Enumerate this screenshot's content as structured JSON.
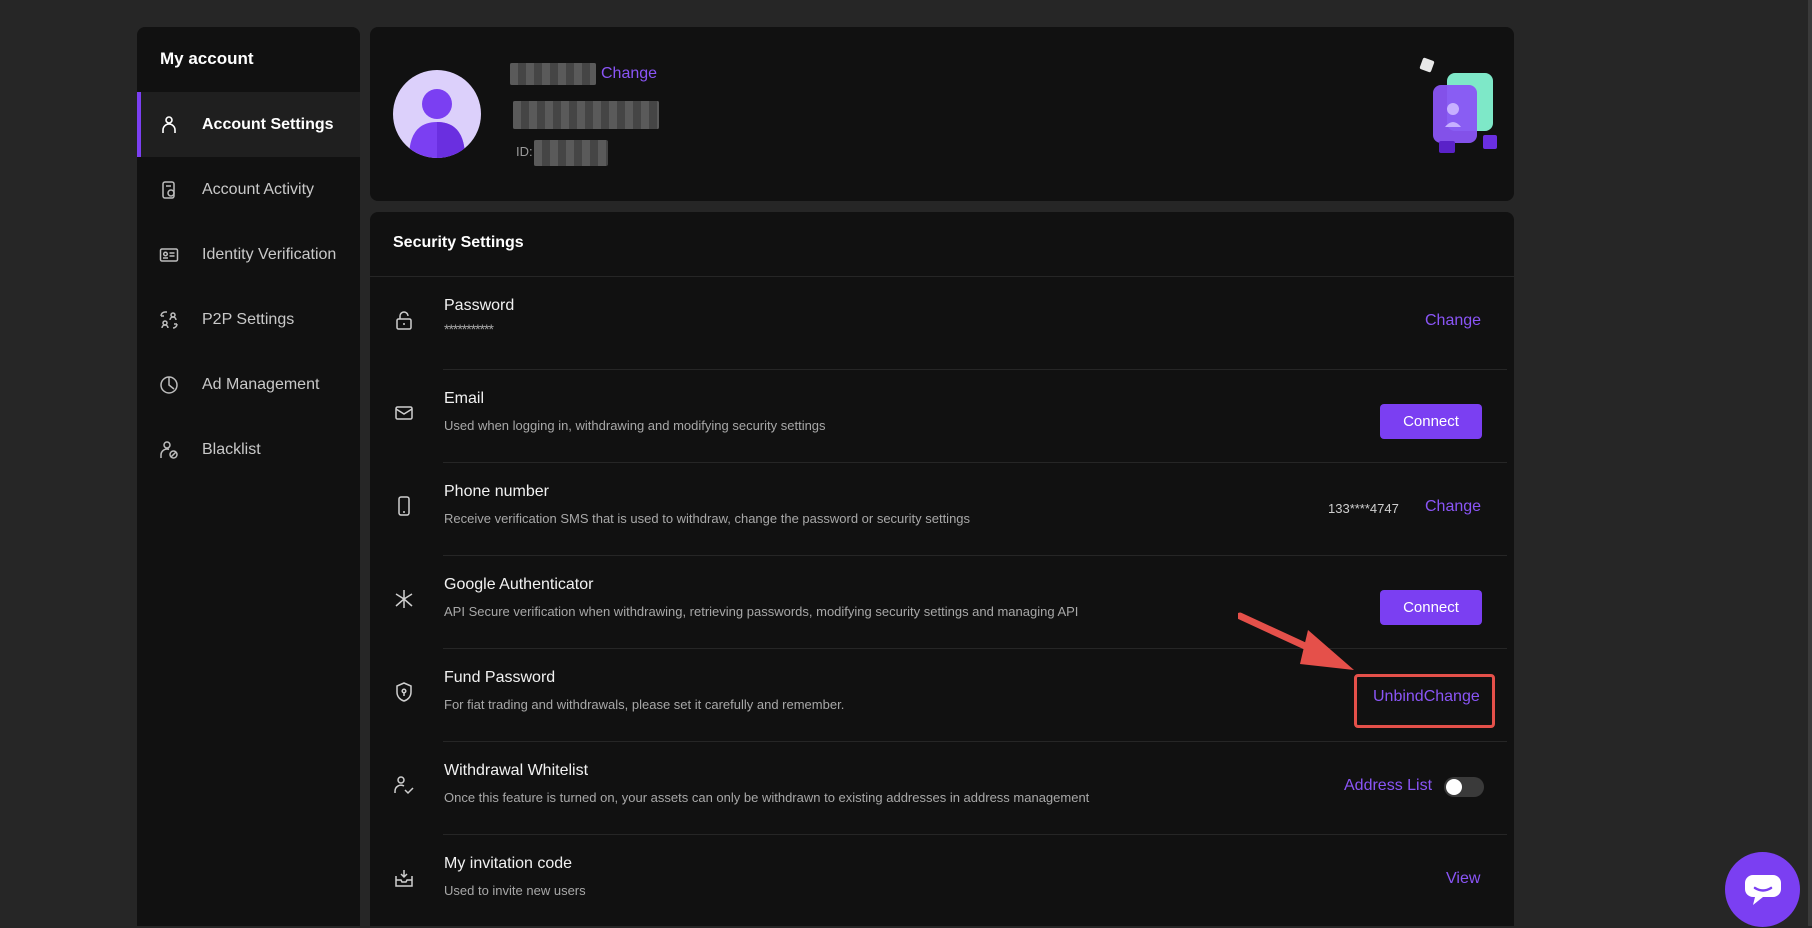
{
  "sidebar": {
    "title": "My account",
    "items": [
      {
        "label": "Account Settings",
        "icon": "user-icon",
        "active": true
      },
      {
        "label": "Account Activity",
        "icon": "activity-icon",
        "active": false
      },
      {
        "label": "Identity Verification",
        "icon": "id-card-icon",
        "active": false
      },
      {
        "label": "P2P Settings",
        "icon": "p2p-icon",
        "active": false
      },
      {
        "label": "Ad Management",
        "icon": "clock-icon",
        "active": false
      },
      {
        "label": "Blacklist",
        "icon": "blacklist-icon",
        "active": false
      }
    ]
  },
  "profile": {
    "change_label": "Change",
    "id_label": "ID:"
  },
  "security": {
    "title": "Security Settings",
    "password": {
      "title": "Password",
      "masked": "***********",
      "action": "Change"
    },
    "email": {
      "title": "Email",
      "desc": "Used when logging in, withdrawing and modifying security settings",
      "action": "Connect"
    },
    "phone": {
      "title": "Phone number",
      "desc": "Receive verification SMS that is used to withdraw, change the password or security settings",
      "value": "133****4747",
      "action": "Change"
    },
    "google": {
      "title": "Google Authenticator",
      "desc": "API Secure verification when withdrawing, retrieving passwords, modifying security settings and managing API",
      "action": "Connect"
    },
    "fund": {
      "title": "Fund Password",
      "desc": "For fiat trading and withdrawals, please set it carefully and remember.",
      "action": "UnbindChange"
    },
    "whitelist": {
      "title": "Withdrawal Whitelist",
      "desc": "Once this feature is turned on, your assets can only be withdrawn to existing addresses in address management",
      "link": "Address List",
      "toggle_on": false
    },
    "invite": {
      "title": "My invitation code",
      "desc": "Used to invite new users",
      "action": "View"
    }
  },
  "colors": {
    "accent": "#7b3ff2",
    "annotation": "#e5504a",
    "panel": "#111111",
    "background": "#262626"
  }
}
